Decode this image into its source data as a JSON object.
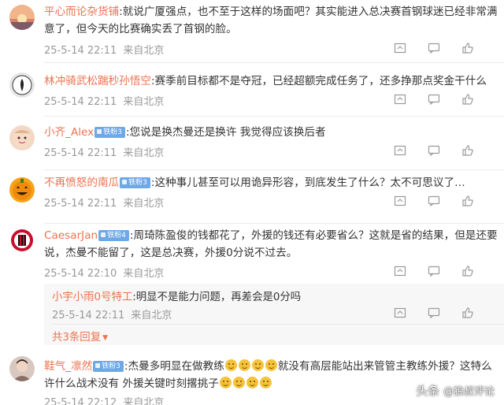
{
  "comments": [
    {
      "username": "平心而论杂货铺",
      "badge": "",
      "text": ":就说广厦强点，也不至于这样的场面吧？其实能进入总决赛首钢球迷已经非常满意了，但今天的比赛确实丢了首钢的脸。",
      "time": "25-5-14 22:11",
      "location": "来自北京",
      "avatar_icon": "sunset-avatar-icon"
    },
    {
      "username": "林冲骑武松踹秒孙悟空",
      "badge": "",
      "text": ":赛季前目标都不是夺冠，已经超额完成任务了，还多挣那点奖金干什么",
      "time": "25-5-14 22:11",
      "location": "来自北京",
      "avatar_icon": "dark-figure-avatar-icon"
    },
    {
      "username": "小齐_Alex",
      "badge": "铁粉3",
      "text": ":您说是换杰曼还是换许 我觉得应该换后者",
      "time": "25-5-14 22:11",
      "location": "来自北京",
      "avatar_icon": "baby-avatar-icon"
    },
    {
      "username": "不再愤怒的南瓜",
      "badge": "铁粉3",
      "text": ":这种事儿甚至可以用诡异形容，到底发生了什么？太不可思议了…",
      "time": "25-5-14 22:11",
      "location": "来自北京",
      "avatar_icon": "pumpkin-avatar-icon"
    },
    {
      "username": "CaesarJan",
      "badge": "铁粉4",
      "text": ":周琦陈盈俊的钱都花了，外援的钱还有必要省么？这就是省的结果，但是还要说，杰曼不能留了，这是总决赛，外援0分说不过去。",
      "time": "25-5-14 22:10",
      "location": "来自北京",
      "avatar_icon": "ac-milan-avatar-icon",
      "reply": {
        "username": "小宇小雨0号特工",
        "text": ":明显不是能力问题，再差会是0分吗",
        "time": "25-5-14 22:11",
        "location": "来自北京",
        "more": "共3条回复"
      }
    },
    {
      "username": "鞋气_凛然",
      "badge": "铁粉3",
      "text_part1": ":杰曼多明显在做教练",
      "text_part2": "就没有高层能站出来管管主教练外援？这特么许什么战术没有 外援关键时刻撂挑子",
      "time": "25-5-14 22:12",
      "location": "来自北京",
      "avatar_icon": "person-avatar-icon"
    }
  ],
  "watermark": {
    "prefix": "头条",
    "handle": "@狼叔评论"
  },
  "action_icons": [
    "share-icon",
    "comment-icon",
    "like-icon",
    "like-count"
  ]
}
